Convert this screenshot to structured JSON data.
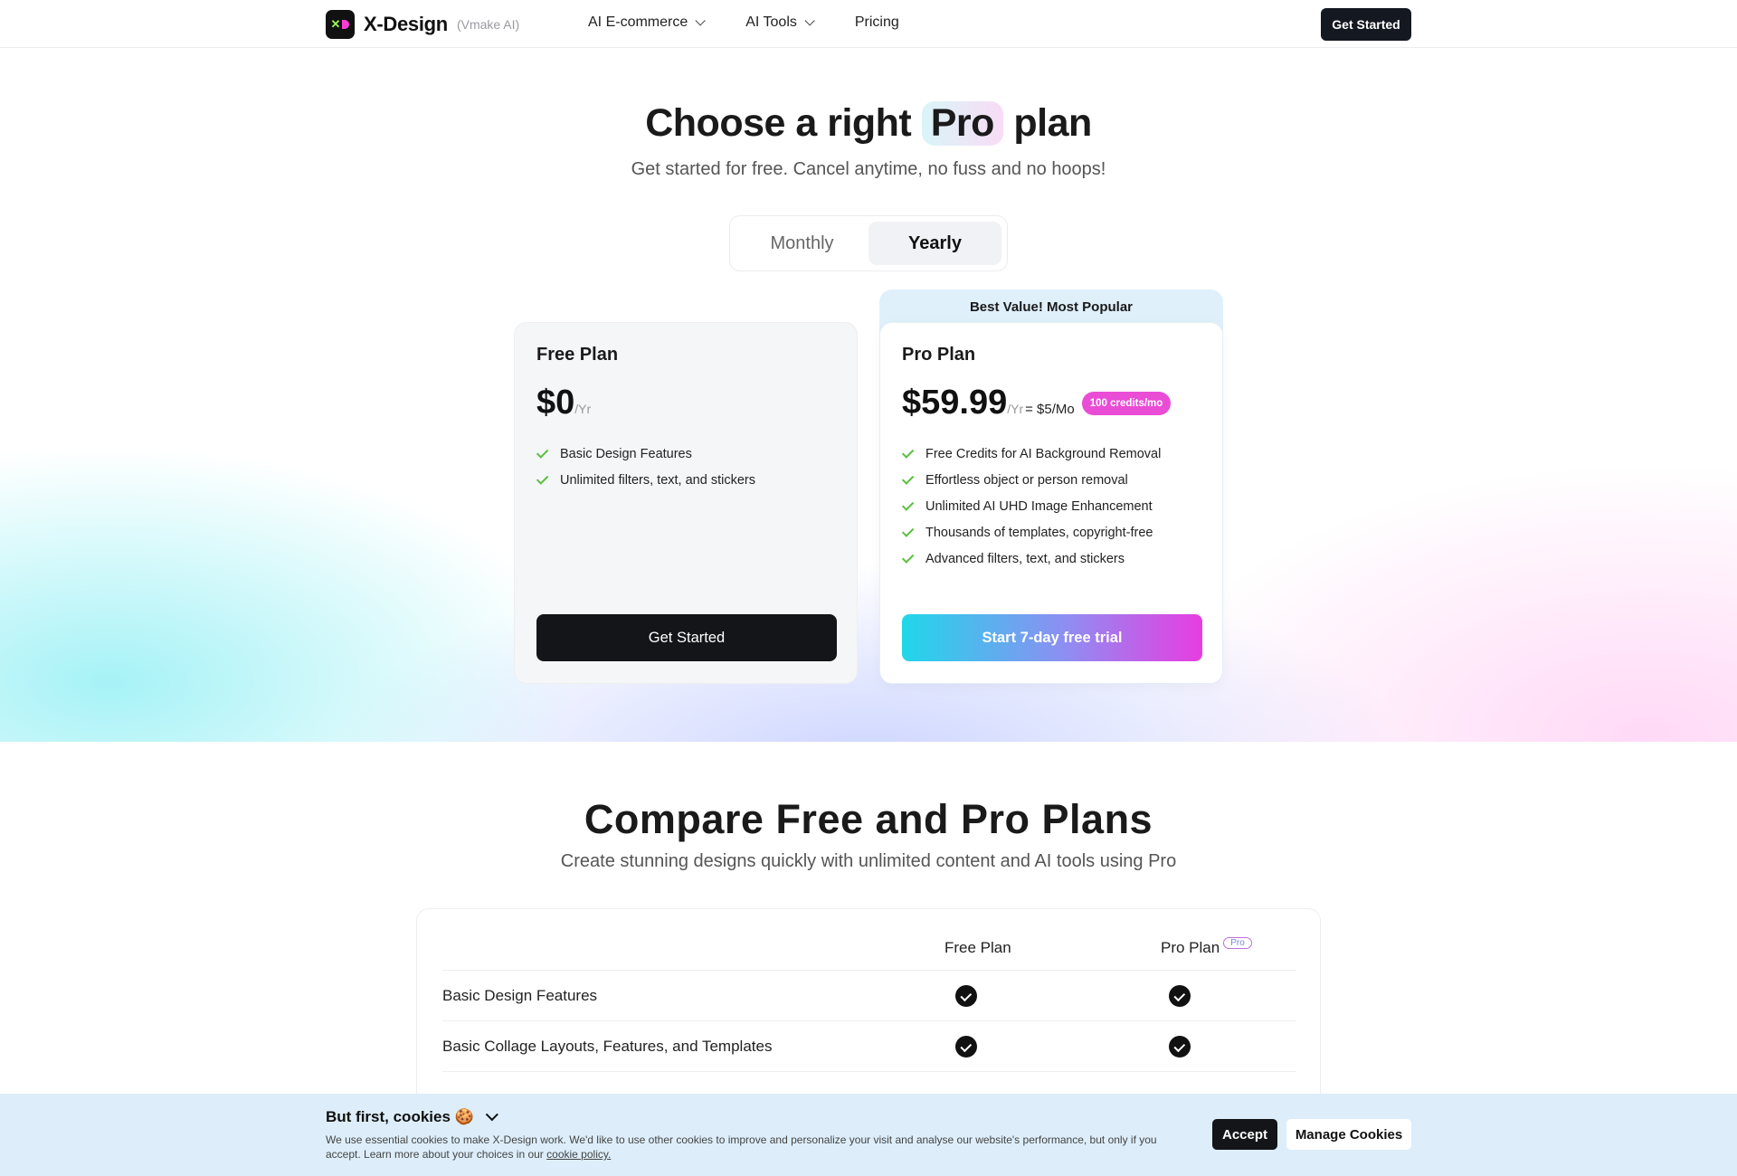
{
  "header": {
    "logo_name": "X-Design",
    "logo_sub": "(Vmake AI)",
    "nav": [
      {
        "label": "AI E-commerce"
      },
      {
        "label": "AI Tools"
      },
      {
        "label": "Pricing"
      }
    ],
    "cta": "Get Started"
  },
  "hero": {
    "title_before": "Choose a right",
    "title_highlight": "Pro",
    "title_after": "plan",
    "subtitle": "Get started for free. Cancel anytime, no fuss and no hoops!",
    "toggle": {
      "monthly": "Monthly",
      "yearly": "Yearly",
      "selected": "Yearly"
    }
  },
  "plans": {
    "free": {
      "name": "Free Plan",
      "price": "$0",
      "period": "/Yr",
      "features": [
        "Basic Design Features",
        "Unlimited filters, text, and stickers"
      ],
      "button": "Get Started"
    },
    "pro": {
      "banner": "Best Value! Most Popular",
      "name": "Pro Plan",
      "price": "$59.99",
      "period": "/Yr",
      "monthly": "= $5/Mo",
      "credits_badge": "100 credits/mo",
      "features": [
        "Free Credits for AI Background Removal",
        "Effortless object or person removal",
        "Unlimited AI UHD Image Enhancement",
        "Thousands of templates, copyright-free",
        "Advanced filters, text, and stickers"
      ],
      "button": "Start 7-day free trial"
    }
  },
  "compare": {
    "title": "Compare Free and Pro Plans",
    "subtitle": "Create stunning designs quickly with unlimited content and AI tools using Pro",
    "col_free": "Free Plan",
    "col_pro": "Pro Plan",
    "pro_tag": "Pro",
    "rows": [
      {
        "feature": "Basic Design Features",
        "free": true,
        "pro": true
      },
      {
        "feature": "Basic Collage Layouts, Features, and Templates",
        "free": true,
        "pro": true
      }
    ]
  },
  "cookie": {
    "title": "But first, cookies 🍪",
    "text": "We use essential cookies to make X-Design work. We'd like to use other cookies to improve and personalize your visit and analyse our website's performance, but only if you accept. Learn more about your choices in our",
    "link": "cookie policy.",
    "accept": "Accept",
    "manage": "Manage Cookies"
  },
  "colors": {
    "accent_green": "#58c03c",
    "credits_pink": "#e94cd5",
    "cta_dark": "#141519",
    "gradient_start": "#21d7ea",
    "gradient_end": "#e73de0"
  }
}
